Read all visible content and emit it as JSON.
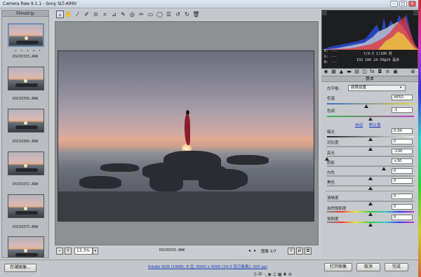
{
  "window": {
    "title": "Camera Raw 9.1.1 - Sony SLT-A99V"
  },
  "filmstrip": {
    "title": "Filmstrip",
    "dots": "• • • • •",
    "items": [
      {
        "name": "DSC03333.ARW",
        "selected": true
      },
      {
        "name": "DSC03358.ARW",
        "selected": false
      },
      {
        "name": "DSC03366.ARW",
        "selected": false
      },
      {
        "name": "DSC03372.ARW",
        "selected": false
      },
      {
        "name": "DSC03373.ARW",
        "selected": false
      },
      {
        "name": "",
        "selected": false
      }
    ]
  },
  "tools": [
    "zoom-icon",
    "hand-icon",
    "white-balance-icon",
    "color-sampler-icon",
    "target-adjust-icon",
    "crop-icon",
    "straighten-icon",
    "spot-removal-icon",
    "red-eye-icon",
    "adjustment-brush-icon",
    "graduated-filter-icon",
    "radial-filter-icon",
    "preferences-icon",
    "rotate-left-icon",
    "rotate-right-icon",
    "trash-icon"
  ],
  "preview": {
    "filename": "DSC03333.ARW",
    "zoom": "13.3%",
    "counter": "图像 1/7"
  },
  "histogram": {
    "r": "R: ---",
    "g": "G: ---",
    "b": "B: ---",
    "aperture_shutter": "f/4.5  1/100 秒",
    "iso_lens": "ISO 100  24-70@24 毫米"
  },
  "panel": {
    "title": "基本",
    "white_balance": {
      "label": "白平衡:",
      "value": "原照设置"
    },
    "temperature": {
      "label": "色温",
      "value": "4650",
      "level": 0.45
    },
    "tint": {
      "label": "色调",
      "value": "-1",
      "level": 0.5
    },
    "auto": "自动",
    "default": "默认值",
    "exposure": {
      "label": "曝光",
      "value": "0.00",
      "level": 0.5
    },
    "contrast": {
      "label": "对比度",
      "value": "0",
      "level": 0.5
    },
    "highlights": {
      "label": "高光",
      "value": "-100",
      "level": 0.0
    },
    "shadows": {
      "label": "阴影",
      "value": "+30",
      "level": 0.65
    },
    "whites": {
      "label": "白色",
      "value": "0",
      "level": 0.5
    },
    "blacks": {
      "label": "黑色",
      "value": "0",
      "level": 0.5
    },
    "clarity": {
      "label": "清晰度",
      "value": "0",
      "level": 0.5
    },
    "vibrance": {
      "label": "自然饱和度",
      "value": "0",
      "level": 0.5
    },
    "saturation": {
      "label": "饱和度",
      "value": "0",
      "level": 0.5
    }
  },
  "bottom": {
    "save_label": "存储图像...",
    "workflow_link": "Adobe RGB (1998); 8 位; 6000 x 4000 (24.0 百万像素); 300 ppi",
    "open_label": "打开图像",
    "cancel_label": "取消",
    "done_label": "完成",
    "ime": "S 中 ·, ◉ ♫ ▦ ♣ ⚙"
  },
  "colors": {
    "accent": "#1a3fbf",
    "selected_thumb": "#6e8fb8"
  }
}
